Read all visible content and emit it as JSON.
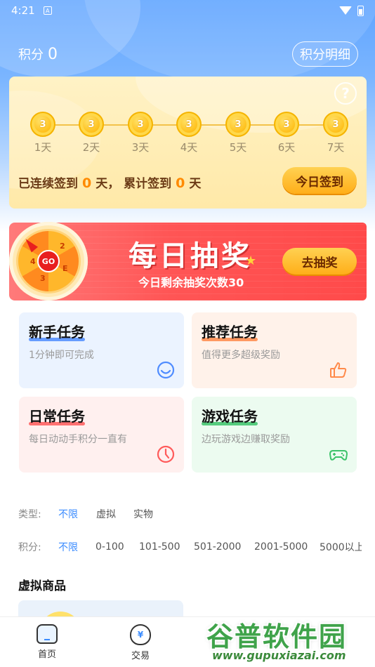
{
  "status_bar": {
    "time": "4:21",
    "notif_letter": "A"
  },
  "header": {
    "points_label": "积分",
    "points_value": "0",
    "detail_button": "积分明细"
  },
  "signin": {
    "help": "?",
    "days": [
      {
        "coin": "3",
        "label": "1天"
      },
      {
        "coin": "3",
        "label": "2天"
      },
      {
        "coin": "3",
        "label": "3天"
      },
      {
        "coin": "3",
        "label": "4天"
      },
      {
        "coin": "3",
        "label": "5天"
      },
      {
        "coin": "3",
        "label": "6天"
      },
      {
        "coin": "3",
        "label": "7天"
      }
    ],
    "summary_prefix": "已连续签到",
    "consecutive_days": "0",
    "summary_mid": "天，  累计签到",
    "total_days": "0",
    "summary_suffix": "天",
    "checkin_button": "今日签到"
  },
  "lottery": {
    "wheel_center": "GO",
    "wheel_numbers": [
      "2",
      "4",
      "3",
      "E"
    ],
    "title": "每日抽奖",
    "subtitle": "今日剩余抽奖次数30",
    "button": "去抽奖"
  },
  "tasks": [
    {
      "title": "新手任务",
      "desc": "1分钟即可完成",
      "icon": "smile-icon",
      "bg": "#ebf3ff",
      "underline": "#4f8cff",
      "icon_color": "#4f8cff"
    },
    {
      "title": "推荐任务",
      "desc": "值得更多超级奖励",
      "icon": "thumbs-up-icon",
      "bg": "#fff2ea",
      "underline": "#ff8a4a",
      "icon_color": "#ff8a4a"
    },
    {
      "title": "日常任务",
      "desc": "每日动动手积分一直有",
      "icon": "clock-icon",
      "bg": "#fff0ef",
      "underline": "#ff5a5a",
      "icon_color": "#ff5a5a"
    },
    {
      "title": "游戏任务",
      "desc": "边玩游戏边赚取奖励",
      "icon": "gamepad-icon",
      "bg": "#ecfbf0",
      "underline": "#3cc36a",
      "icon_color": "#3cc36a"
    }
  ],
  "filters": {
    "type_label": "类型:",
    "type_options": [
      "不限",
      "虚拟",
      "实物"
    ],
    "type_selected": "不限",
    "points_label": "积分:",
    "points_options": [
      "不限",
      "0-100",
      "101-500",
      "501-2000",
      "2001-5000",
      "5000以上"
    ],
    "points_selected": "不限"
  },
  "section_title": "虚拟商品",
  "bottom_nav": [
    {
      "label": "首页",
      "icon": "home-icon"
    },
    {
      "label": "交易",
      "icon": "money-bag-icon",
      "glyph": "¥"
    }
  ],
  "watermark": {
    "name": "谷普软件园",
    "url": "www.gupuxiazai.com"
  },
  "colors": {
    "accent": "#3b8cff",
    "orange": "#ff8a00",
    "banner_red": "#ff5555"
  }
}
